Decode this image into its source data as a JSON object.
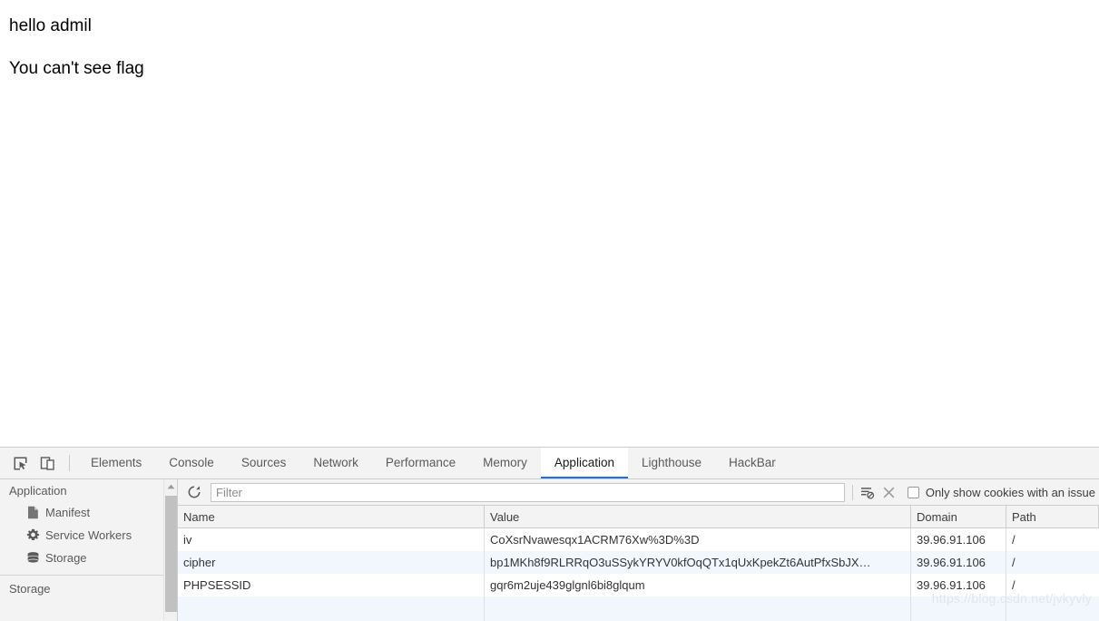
{
  "page": {
    "line1": "hello admil",
    "line2": "You can't see flag"
  },
  "devtools": {
    "icons": {
      "inspect": "inspect-element-icon",
      "device": "device-toolbar-icon"
    },
    "tabs": [
      {
        "label": "Elements",
        "active": false
      },
      {
        "label": "Console",
        "active": false
      },
      {
        "label": "Sources",
        "active": false
      },
      {
        "label": "Network",
        "active": false
      },
      {
        "label": "Performance",
        "active": false
      },
      {
        "label": "Memory",
        "active": false
      },
      {
        "label": "Application",
        "active": true
      },
      {
        "label": "Lighthouse",
        "active": false
      },
      {
        "label": "HackBar",
        "active": false
      }
    ],
    "active_tab": "Application",
    "accent_color": "#1a73e8"
  },
  "sidebar": {
    "section_application": "Application",
    "items": [
      {
        "label": "Manifest",
        "icon": "manifest-document-icon"
      },
      {
        "label": "Service Workers",
        "icon": "gear-icon"
      },
      {
        "label": "Storage",
        "icon": "database-icon"
      }
    ],
    "section_storage": "Storage"
  },
  "toolbar": {
    "refresh_icon": "refresh-icon",
    "filter": {
      "value": "",
      "placeholder": "Filter"
    },
    "clear_filtered_icon": "clear-filtered-cookies-icon",
    "clear_all_icon": "clear-all-cookies-icon",
    "issue_filter_label": "Only show cookies with an issue",
    "issue_filter_checked": false
  },
  "cookie_table": {
    "columns": [
      "Name",
      "Value",
      "Domain",
      "Path"
    ],
    "rows": [
      {
        "name": "iv",
        "value": "CoXsrNvawesqx1ACRM76Xw%3D%3D",
        "domain": "39.96.91.106",
        "path": "/"
      },
      {
        "name": "cipher",
        "value": "bp1MKh8f9RLRRqO3uSSykYRYV0kfOqQTx1qUxKpekZt6AutPfxSbJX…",
        "domain": "39.96.91.106",
        "path": "/"
      },
      {
        "name": "PHPSESSID",
        "value": "gqr6m2uje439glgnl6bi8glqum",
        "domain": "39.96.91.106",
        "path": "/"
      }
    ]
  },
  "watermark": "https://blog.csdn.net/jvkyvly"
}
